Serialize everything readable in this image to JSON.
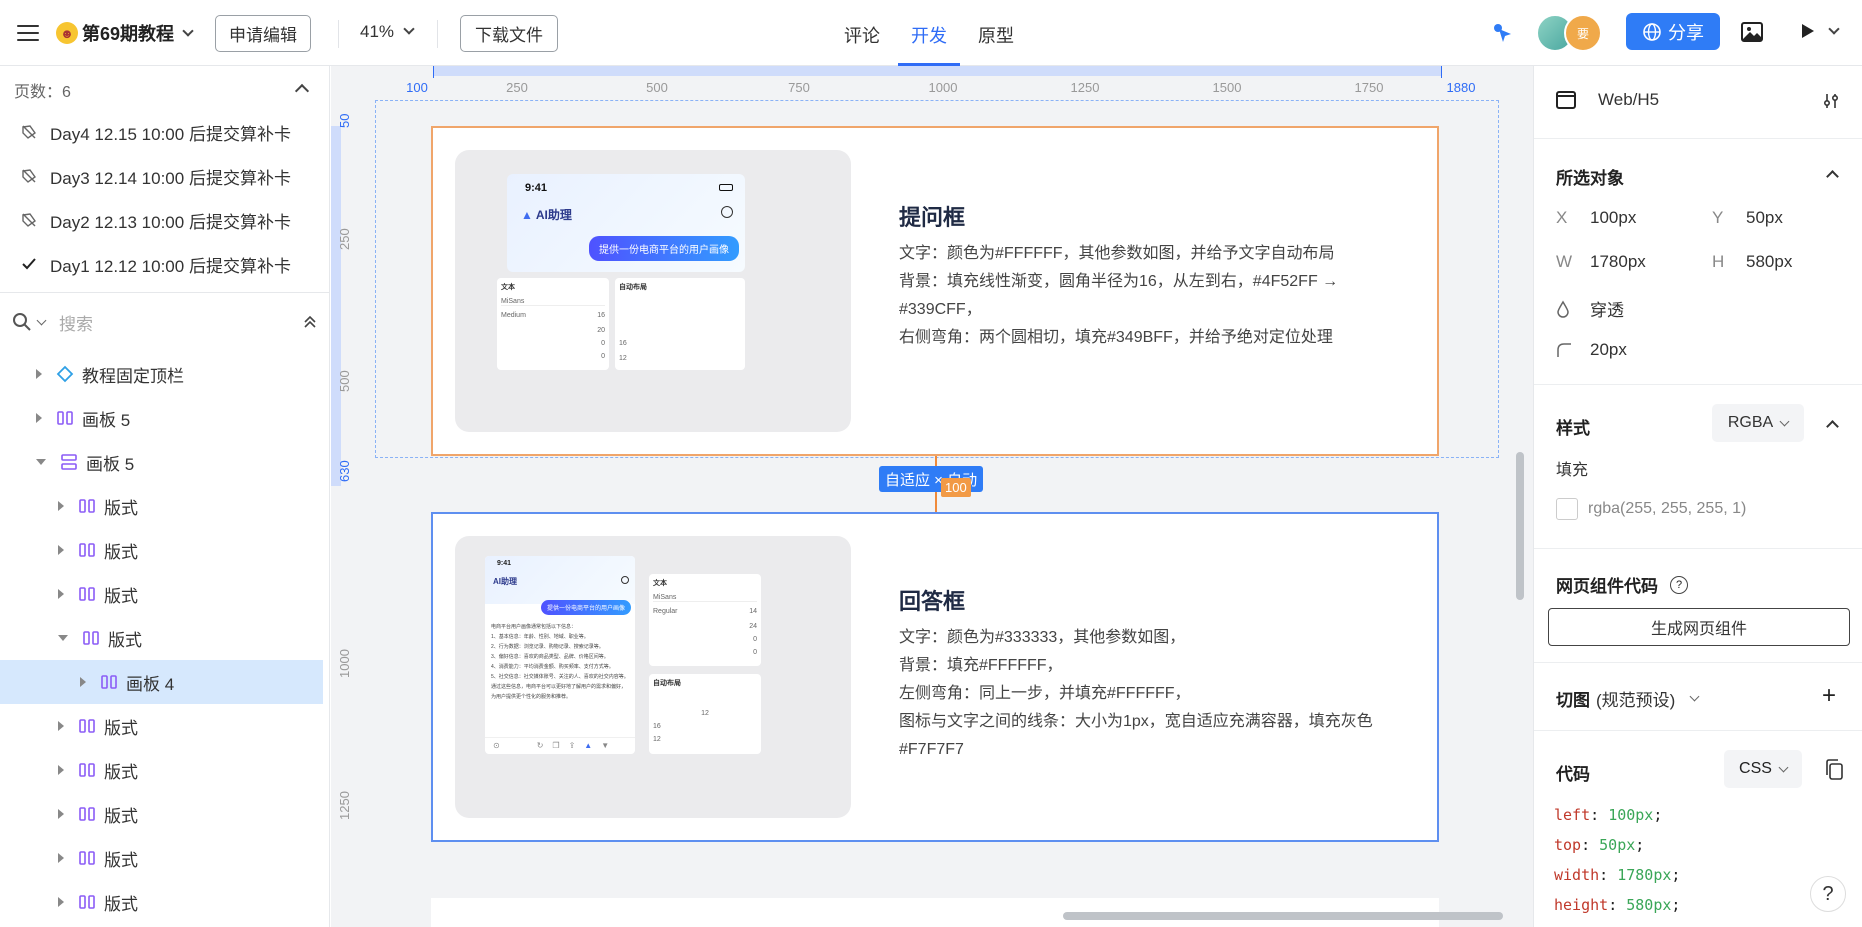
{
  "topbar": {
    "file_title": "第69期教程",
    "request_edit": "申请编辑",
    "zoom": "41%",
    "download": "下载文件",
    "tabs": [
      "评论",
      "开发",
      "原型"
    ],
    "active_tab": "开发",
    "avatar2": "要",
    "share": "分享"
  },
  "sidebar": {
    "pages_label": "页数：6",
    "pages": [
      {
        "label": "Day4 12.15 10:00 后提交算补卡",
        "checked": false
      },
      {
        "label": "Day3 12.14 10:00 后提交算补卡",
        "checked": false
      },
      {
        "label": "Day2 12.13 10:00 后提交算补卡",
        "checked": false
      },
      {
        "label": "Day1 12.12 10:00 后提交算补卡",
        "checked": true
      }
    ],
    "search_placeholder": "搜索",
    "layers": [
      {
        "label": "教程固定顶栏",
        "icon": "component-diamond-icon"
      },
      {
        "label": "画板 5",
        "icon": "frame-columns-icon"
      },
      {
        "label": "画板 5",
        "icon": "frame-rows-icon",
        "expanded": true
      },
      {
        "label": "版式",
        "icon": "frame-columns-icon"
      },
      {
        "label": "版式",
        "icon": "frame-columns-icon"
      },
      {
        "label": "版式",
        "icon": "frame-columns-icon"
      },
      {
        "label": "版式",
        "icon": "frame-columns-icon",
        "expanded": true
      },
      {
        "label": "画板 4",
        "icon": "frame-columns-icon",
        "selected": true
      },
      {
        "label": "版式",
        "icon": "frame-columns-icon"
      },
      {
        "label": "版式",
        "icon": "frame-columns-icon"
      },
      {
        "label": "版式",
        "icon": "frame-columns-icon"
      },
      {
        "label": "版式",
        "icon": "frame-columns-icon"
      },
      {
        "label": "版式",
        "icon": "frame-columns-icon"
      }
    ]
  },
  "canvas": {
    "ruler_top": [
      "100",
      "250",
      "500",
      "750",
      "1000",
      "1250",
      "1500",
      "1750",
      "1880"
    ],
    "ruler_left": [
      "50",
      "250",
      "500",
      "630",
      "1000",
      "1250"
    ],
    "card1": {
      "title": "提问框",
      "lines": [
        "文字：颜色为#FFFFFF，其他参数如图，并给予文字自动布局",
        "背景：填充线性渐变，圆角半径为16，从左到右，#4F52FF → #339CFF，",
        "右侧弯角：两个圆相切，填充#349BFF，并给予绝对定位处理"
      ],
      "mock": {
        "time": "9:41",
        "brand": "AI助理",
        "bubble": "提供一份电商平台的用户画像",
        "text_panel": "文本",
        "layout_panel": "自动布局",
        "font": "MiSans",
        "weight": "Medium",
        "size": "16",
        "v20": "20",
        "v0a": "0",
        "v0b": "0",
        "pad16": "16",
        "pad12": "12"
      }
    },
    "gap_label": "自适应 × 自动",
    "gap_value": "100",
    "card2": {
      "title": "回答框",
      "lines": [
        "文字：颜色为#333333，其他参数如图，",
        "背景：填充#FFFFFF，",
        "左侧弯角：同上一步，并填充#FFFFFF，",
        "图标与文字之间的线条：大小为1px，宽自适应充满容器，填充灰色#F7F7F7"
      ],
      "mock": {
        "time": "9:41",
        "brand": "AI助理",
        "bubble": "提供一份电商平台的用户画像",
        "answer_lines": [
          "电商平台用户画像通常包括以下信息：",
          "1、基本信息：年龄、性别、地域、职业等。",
          "2、行为数据：浏览记录、购物记录、搜索记录等。",
          "3、偏好信息：喜欢的商品类型、品牌、价格区间等。",
          "4、消费能力：平均消费金额、购买频率、支付方式等。",
          "5、社交信息：社交媒体账号、关注的人、喜欢的社交内容等。",
          "通过这些信息，电商平台可以更好地了解用户的需求和偏好，为用户提供更个性化的服务和推荐。"
        ],
        "text_panel": "文本",
        "layout_panel": "自动布局",
        "font": "MiSans",
        "weight": "Regular",
        "size": "14",
        "v24": "24",
        "v0a": "0",
        "v0b": "0",
        "v12": "12",
        "pad16": "16",
        "pad12": "12"
      }
    }
  },
  "rpanel": {
    "platform": "Web/H5",
    "selected_title": "所选对象",
    "x_label": "X",
    "x_value": "100px",
    "y_label": "Y",
    "y_value": "50px",
    "w_label": "W",
    "w_value": "1780px",
    "h_label": "H",
    "h_value": "580px",
    "opacity": "穿透",
    "radius": "20px",
    "style_title": "样式",
    "color_mode": "RGBA",
    "fill_label": "填充",
    "fill_value": "rgba(255, 255, 255, 1)",
    "web_code_title": "网页组件代码",
    "generate": "生成网页组件",
    "slice_title": "切图",
    "slice_preset": "(规范预设)",
    "code_title": "代码",
    "code_lang": "CSS",
    "code": [
      {
        "prop": "left",
        "val": "100px"
      },
      {
        "prop": "top",
        "val": "50px"
      },
      {
        "prop": "width",
        "val": "1780px"
      },
      {
        "prop": "height",
        "val": "580px"
      }
    ],
    "help": "?"
  },
  "colors": {
    "accent": "#2f6cf6",
    "frame_orange": "#f0a56a",
    "frame_blue": "#5e8ff0",
    "selected_row": "#d6e8fd"
  }
}
